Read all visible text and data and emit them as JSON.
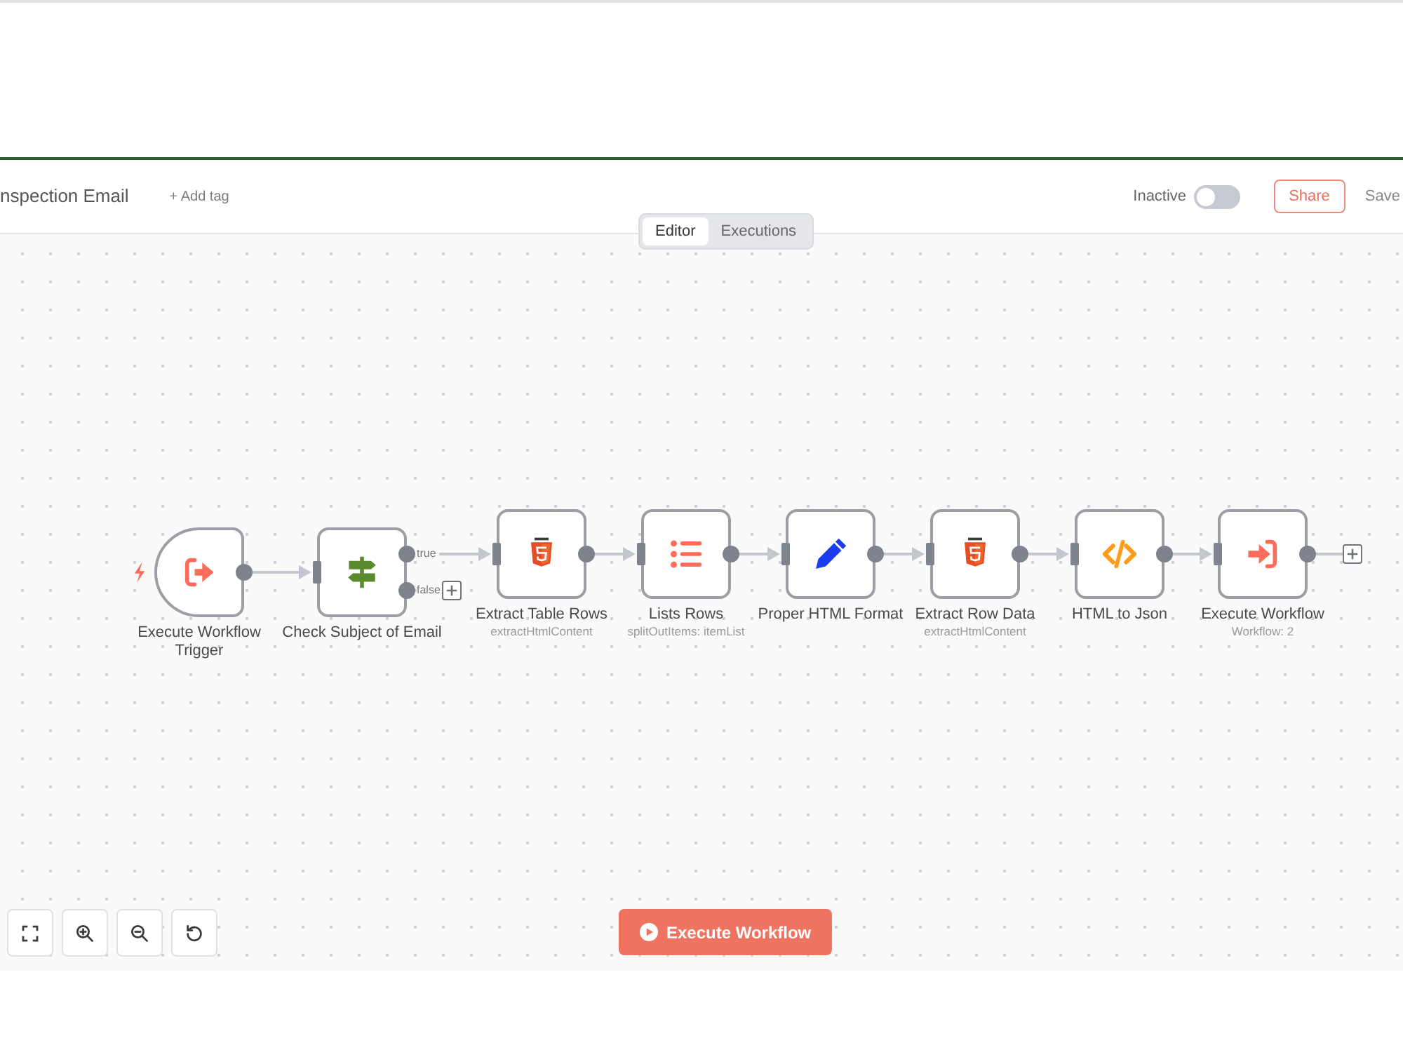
{
  "header": {
    "title": "nspection Email",
    "add_tag": "+ Add tag",
    "active_label": "Inactive",
    "active": false,
    "share": "Share",
    "save_status": "Save"
  },
  "view_tabs": [
    {
      "label": "Editor",
      "selected": true
    },
    {
      "label": "Executions",
      "selected": false
    }
  ],
  "nodes": [
    {
      "name": "Execute Workflow Trigger",
      "kind": "trigger",
      "outputs": [
        {
          "connected": true
        }
      ]
    },
    {
      "name": "Check Subject of Email",
      "kind": "condition",
      "outputs": [
        {
          "label": "true",
          "connected": true
        },
        {
          "label": "false",
          "connected": false
        }
      ]
    },
    {
      "name": "Extract Table Rows",
      "kind": "html",
      "subtitle": "extractHtmlContent",
      "outputs": [
        {
          "connected": true
        }
      ]
    },
    {
      "name": "Lists Rows",
      "kind": "list",
      "subtitle": "splitOutItems: itemList",
      "outputs": [
        {
          "connected": true
        }
      ]
    },
    {
      "name": "Proper HTML Format",
      "kind": "edit",
      "outputs": [
        {
          "connected": true
        }
      ]
    },
    {
      "name": "Extract Row Data",
      "kind": "html",
      "subtitle": "extractHtmlContent",
      "outputs": [
        {
          "connected": true
        }
      ]
    },
    {
      "name": "HTML to Json",
      "kind": "code",
      "outputs": [
        {
          "connected": true
        }
      ]
    },
    {
      "name": "Execute Workflow",
      "kind": "subworkflow",
      "subtitle": "Workflow: 2",
      "outputs": [
        {
          "connected": false
        }
      ]
    }
  ],
  "zoom_controls": [
    {
      "kind": "fit"
    },
    {
      "kind": "zoom_in"
    },
    {
      "kind": "zoom_out"
    },
    {
      "kind": "reset"
    }
  ],
  "execute_button": "Execute Workflow"
}
